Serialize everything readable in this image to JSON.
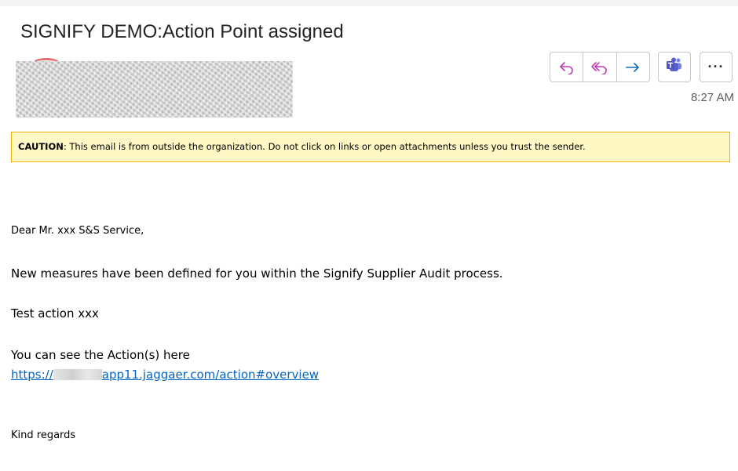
{
  "email": {
    "subject": "SIGNIFY DEMO:Action Point assigned",
    "timestamp": "8:27 AM",
    "caution_label": "CAUTION",
    "caution_text": ": This email is from outside the organization. Do not click on links or open attachments unless you trust the sender.",
    "greeting": "Dear Mr. xxx S&S Service,",
    "paragraph1": "New measures have been defined for you within the Signify Supplier Audit process.",
    "paragraph2": "Test action xxx",
    "paragraph3": "You can see the Action(s) here",
    "link_prefix": "https://",
    "link_suffix": "app11.jaggaer.com/action#overview",
    "closing": "Kind regards"
  },
  "toolbar": {
    "reply_icon": "reply-icon",
    "reply_all_icon": "reply-all-icon",
    "forward_icon": "forward-icon",
    "teams_icon": "teams-icon",
    "more_icon": "more-icon",
    "more_label": "···"
  },
  "colors": {
    "reply_accent": "#c239b3",
    "forward_accent": "#0f6cbd",
    "teams_purple": "#5b5fc7",
    "caution_bg": "#fff8c5",
    "caution_border": "#f0b400",
    "link": "#0563c1"
  }
}
